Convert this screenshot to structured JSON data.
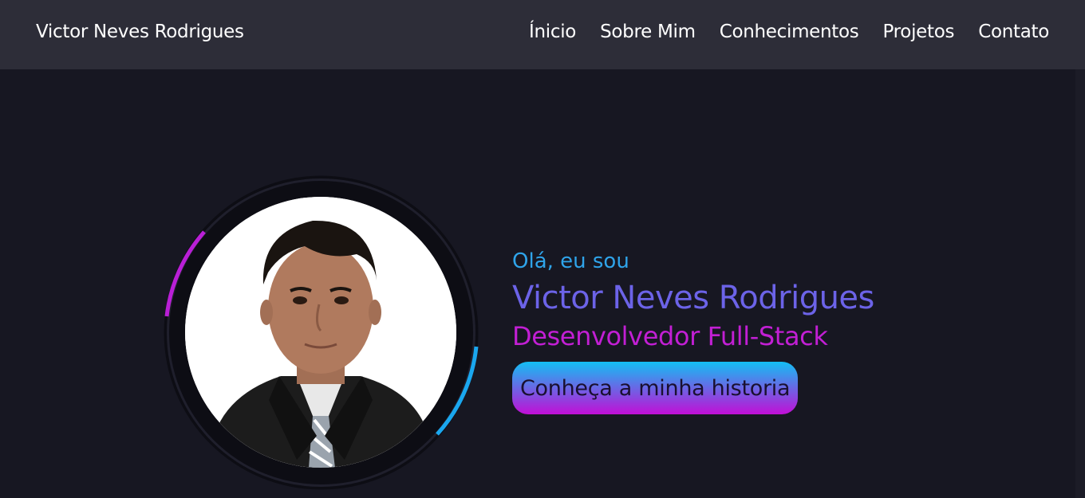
{
  "header": {
    "brand": "Victor Neves Rodrigues",
    "nav": [
      {
        "label": "Ínicio"
      },
      {
        "label": "Sobre Mim"
      },
      {
        "label": "Conhecimentos"
      },
      {
        "label": "Projetos"
      },
      {
        "label": "Contato"
      }
    ]
  },
  "hero": {
    "greeting": "Olá, eu sou",
    "name": "Victor Neves Rodrigues",
    "role": "Desenvolvedor Full-Stack",
    "cta_label": "Conheça a minha historia"
  },
  "colors": {
    "background": "#171722",
    "navbar": "#2d2d38",
    "greeting": "#2fa4ea",
    "name": "#6c63e8",
    "role": "#c21fd4",
    "ring_blue": "#1aa7ef",
    "ring_purple": "#b91fd6"
  }
}
